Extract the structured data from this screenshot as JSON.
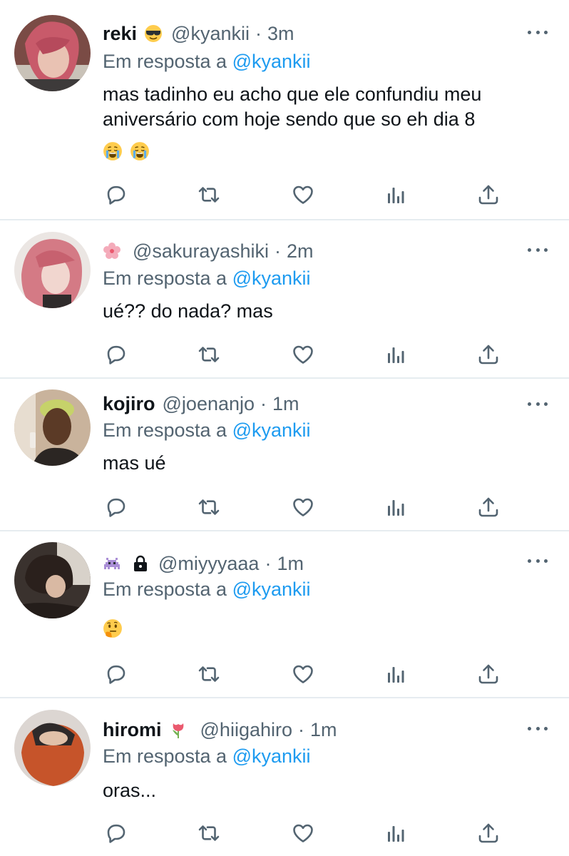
{
  "reply_prefix": "Em resposta a",
  "colors": {
    "link": "#1d9bf0",
    "secondary_text": "#536471",
    "divider": "#e6ecf0"
  },
  "tweets": [
    {
      "name": "reki",
      "name_emoji": "sunglasses-face-emoji",
      "handle": "@kyankii",
      "separator": "·",
      "time": "3m",
      "reply_to": "@kyankii",
      "text": "mas tadinho eu acho que ele confundiu meu aniversário com hoje sendo que so eh dia 8",
      "text_emojis": [
        "loudly-crying-face-emoji",
        "loudly-crying-face-emoji"
      ]
    },
    {
      "name": "",
      "name_emoji": "cherry-blossom-emoji",
      "handle": "@sakurayashiki",
      "separator": "·",
      "time": "2m",
      "reply_to": "@kyankii",
      "text": "ué?? do nada? mas"
    },
    {
      "name": "kojiro",
      "handle": "@joenanjo",
      "separator": "·",
      "time": "1m",
      "reply_to": "@kyankii",
      "text": "mas ué"
    },
    {
      "name": "",
      "name_emoji": "alien-monster-emoji",
      "protected_icon": "lock-icon",
      "handle": "@miyyyaaa",
      "separator": "·",
      "time": "1m",
      "reply_to": "@kyankii",
      "text_emojis": [
        "thinking-face-emoji"
      ]
    },
    {
      "name": "hiromi",
      "name_emoji": "tulip-emoji",
      "handle": "@hiigahiro",
      "separator": "·",
      "time": "1m",
      "reply_to": "@kyankii",
      "text": "oras..."
    }
  ]
}
